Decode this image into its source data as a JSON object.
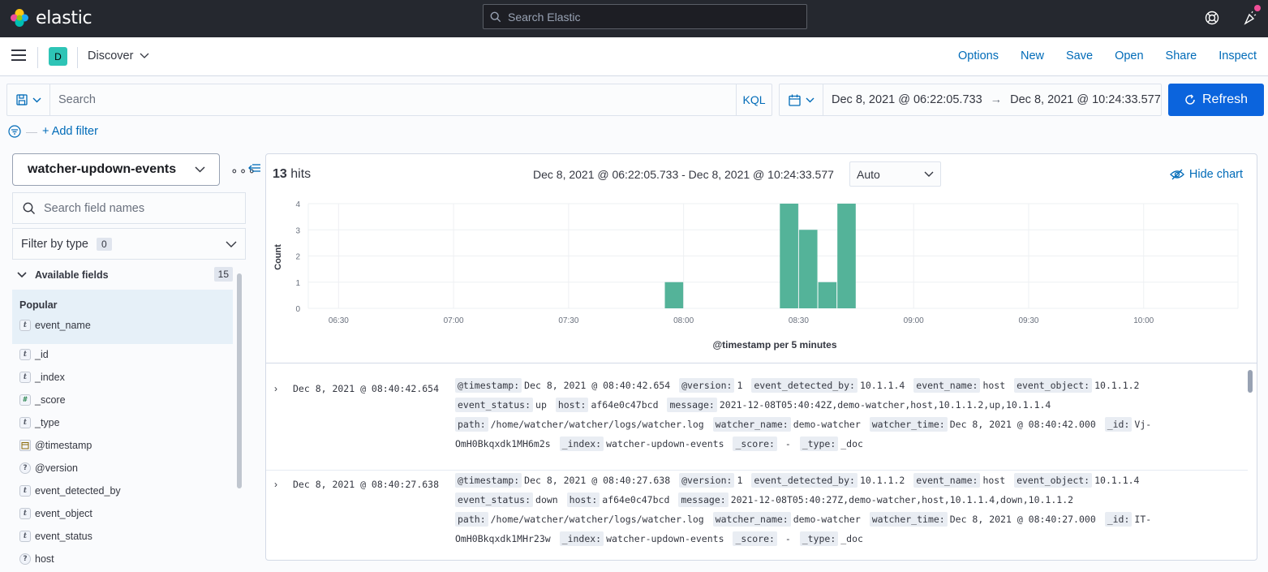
{
  "topbar": {
    "logo_text": "elastic",
    "search_placeholder": "Search Elastic"
  },
  "header": {
    "space_initial": "D",
    "breadcrumb": "Discover",
    "links": [
      "Options",
      "New",
      "Save",
      "Open",
      "Share",
      "Inspect"
    ]
  },
  "querybar": {
    "placeholder": "Search",
    "language": "KQL"
  },
  "datepicker": {
    "start": "Dec 8, 2021 @ 06:22:05.733",
    "arrow": "→",
    "end": "Dec 8, 2021 @ 10:24:33.577"
  },
  "refresh_label": "Refresh",
  "add_filter_label": "+ Add filter",
  "sidebar": {
    "index_pattern": "watcher-updown-events",
    "field_search_placeholder": "Search field names",
    "filter_by_type_label": "Filter by type",
    "filter_by_type_count": "0",
    "available_label": "Available fields",
    "available_count": "15",
    "popular_label": "Popular",
    "popular_fields": [
      {
        "name": "event_name",
        "type": "t"
      }
    ],
    "fields": [
      {
        "name": "_id",
        "type": "t"
      },
      {
        "name": "_index",
        "type": "t"
      },
      {
        "name": "_score",
        "type": "#"
      },
      {
        "name": "_type",
        "type": "t"
      },
      {
        "name": "@timestamp",
        "type": "date"
      },
      {
        "name": "@version",
        "type": "?"
      },
      {
        "name": "event_detected_by",
        "type": "t"
      },
      {
        "name": "event_object",
        "type": "t"
      },
      {
        "name": "event_status",
        "type": "t"
      },
      {
        "name": "host",
        "type": "?"
      }
    ]
  },
  "results": {
    "hits_count": "13",
    "hits_label": "hits",
    "range_text": "Dec 8, 2021 @ 06:22:05.733 - Dec 8, 2021 @ 10:24:33.577",
    "interval": "Auto",
    "hide_chart_label": "Hide chart"
  },
  "chart_data": {
    "type": "bar",
    "ylabel": "Count",
    "xlabel": "@timestamp per 5 minutes",
    "ylim": [
      0,
      4
    ],
    "y_ticks": [
      "0",
      "1",
      "2",
      "3",
      "4"
    ],
    "x_ticks": [
      "06:30",
      "07:00",
      "07:30",
      "08:00",
      "08:30",
      "09:00",
      "09:30",
      "10:00"
    ],
    "x_range_minutes": [
      382.1,
      624.6
    ],
    "bin_minutes": 5,
    "bars": [
      {
        "start": "07:55",
        "value": 1
      },
      {
        "start": "08:25",
        "value": 4
      },
      {
        "start": "08:30",
        "value": 3
      },
      {
        "start": "08:35",
        "value": 1
      },
      {
        "start": "08:40",
        "value": 4
      }
    ],
    "bar_color": "#54b399",
    "grid": true
  },
  "documents": [
    {
      "time": "Dec 8, 2021 @ 08:40:42.654",
      "fields": [
        [
          "@timestamp:",
          "Dec 8, 2021 @ 08:40:42.654"
        ],
        [
          "@version:",
          "1"
        ],
        [
          "event_detected_by:",
          "10.1.1.4"
        ],
        [
          "event_name:",
          "host"
        ],
        [
          "event_object:",
          "10.1.1.2"
        ],
        [
          "event_status:",
          "up"
        ],
        [
          "host:",
          "af64e0c47bcd"
        ],
        [
          "message:",
          "2021-12-08T05:40:42Z,demo-watcher,host,10.1.1.2,up,10.1.1.4"
        ],
        [
          "path:",
          "/home/watcher/watcher/logs/watcher.log"
        ],
        [
          "watcher_name:",
          "demo-watcher"
        ],
        [
          "watcher_time:",
          "Dec 8, 2021 @ 08:40:42.000"
        ],
        [
          "_id:",
          "Vj-OmH0Bkqxdk1MH6m2s"
        ],
        [
          "_index:",
          "watcher-updown-events"
        ],
        [
          "_score:",
          " - "
        ],
        [
          "_type:",
          "_doc"
        ]
      ]
    },
    {
      "time": "Dec 8, 2021 @ 08:40:27.638",
      "fields": [
        [
          "@timestamp:",
          "Dec 8, 2021 @ 08:40:27.638"
        ],
        [
          "@version:",
          "1"
        ],
        [
          "event_detected_by:",
          "10.1.1.2"
        ],
        [
          "event_name:",
          "host"
        ],
        [
          "event_object:",
          "10.1.1.4"
        ],
        [
          "event_status:",
          "down"
        ],
        [
          "host:",
          "af64e0c47bcd"
        ],
        [
          "message:",
          "2021-12-08T05:40:27Z,demo-watcher,host,10.1.1.4,down,10.1.1.2"
        ],
        [
          "path:",
          "/home/watcher/watcher/logs/watcher.log"
        ],
        [
          "watcher_name:",
          "demo-watcher"
        ],
        [
          "watcher_time:",
          "Dec 8, 2021 @ 08:40:27.000"
        ],
        [
          "_id:",
          "IT-OmH0Bkqxdk1MHr23w"
        ],
        [
          "_index:",
          "watcher-updown-events"
        ],
        [
          "_score:",
          " - "
        ],
        [
          "_type:",
          "_doc"
        ]
      ]
    }
  ],
  "colors": {
    "accent": "#006bb8",
    "primary_button": "#0b64dd",
    "topbar": "#25282f",
    "bar": "#54b399"
  }
}
